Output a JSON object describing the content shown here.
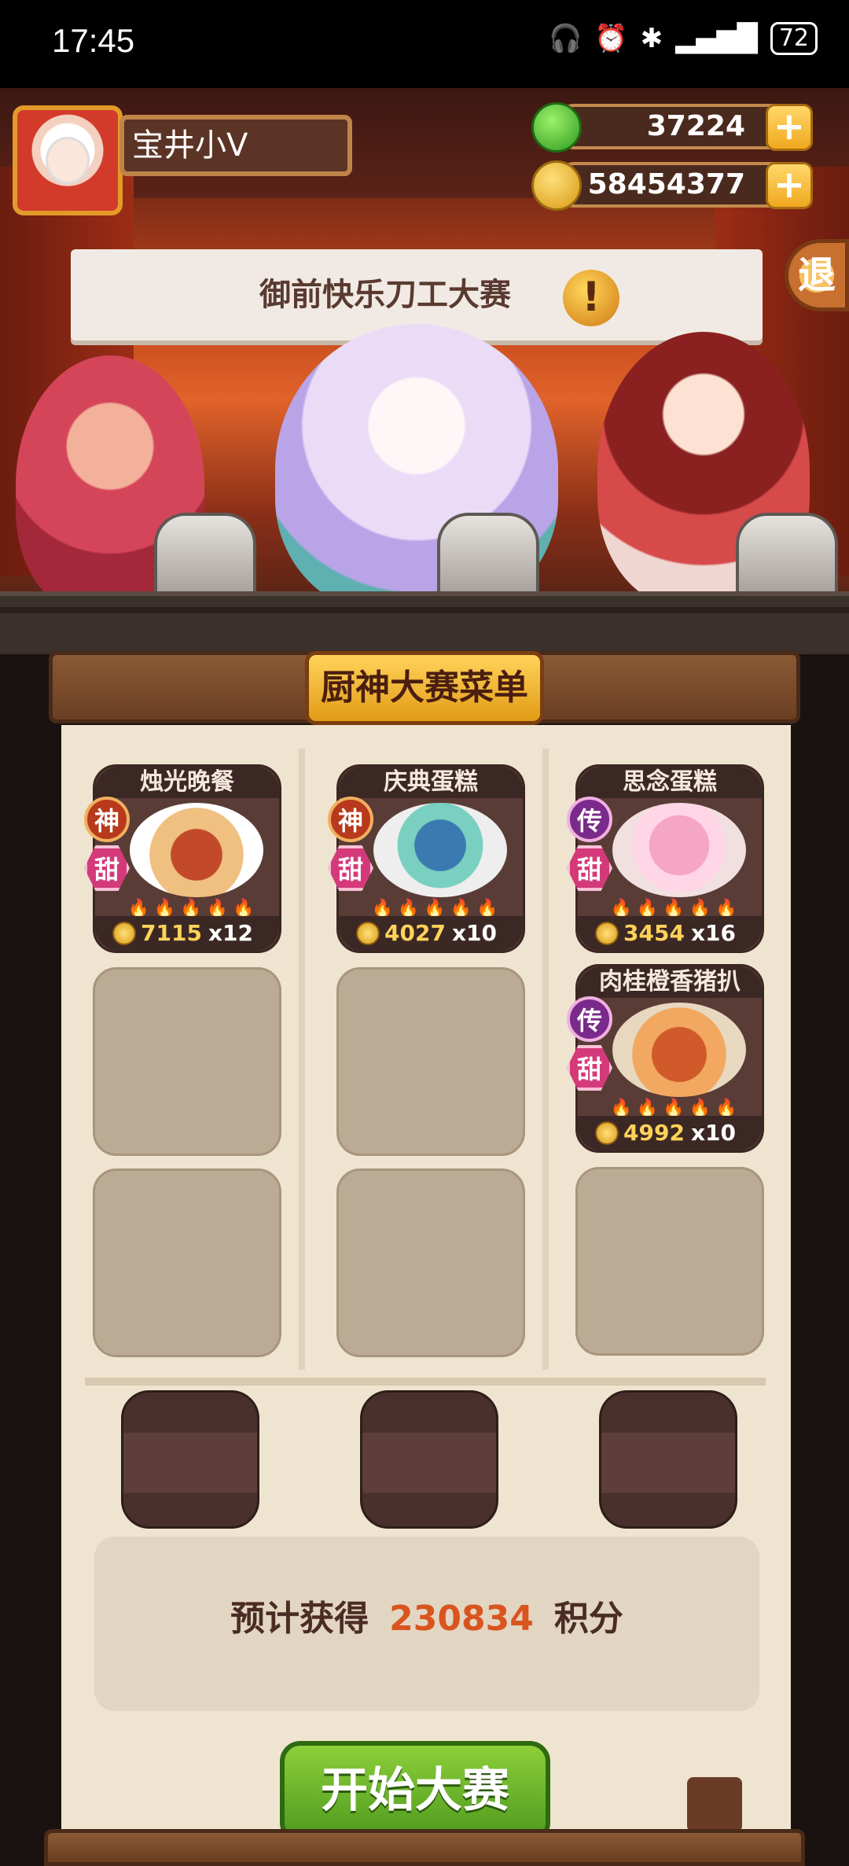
{
  "status_bar": {
    "time": "17:45",
    "battery": "72",
    "icons": [
      "headphones-icon",
      "alarm-icon",
      "bluetooth-icon",
      "signal-icon",
      "battery-icon"
    ]
  },
  "player": {
    "name": "宝井小V",
    "jade": "37224",
    "coins": "58454377"
  },
  "scene": {
    "banner_title": "御前快乐刀工大赛",
    "exit_label": "退"
  },
  "menu": {
    "title": "厨神大赛菜单",
    "dishes": [
      {
        "name": "烛光晚餐",
        "rank": "神",
        "taste": "甜",
        "price": "7115",
        "qty": "x12",
        "flames": 5
      },
      {
        "name": "庆典蛋糕",
        "rank": "神",
        "taste": "甜",
        "price": "4027",
        "qty": "x10",
        "flames": 5
      },
      {
        "name": "思念蛋糕",
        "rank": "传",
        "taste": "甜",
        "price": "3454",
        "qty": "x16",
        "flames": 5
      },
      {
        "name": "肉桂橙香猪扒",
        "rank": "传",
        "taste": "甜",
        "price": "4992",
        "qty": "x10",
        "flames": 5
      }
    ]
  },
  "score": {
    "prefix": "预计获得",
    "value": "230834",
    "suffix": "积分"
  },
  "start_button": "开始大赛"
}
